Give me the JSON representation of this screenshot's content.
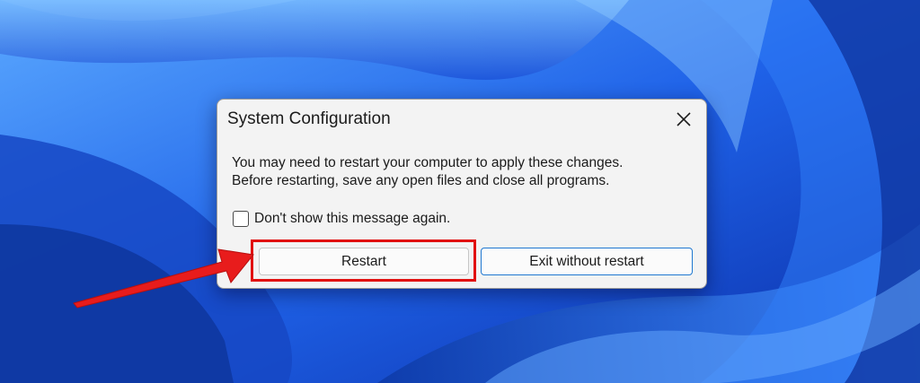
{
  "dialog": {
    "title": "System Configuration",
    "message_line1": "You may need to restart your computer to apply these changes.",
    "message_line2": "Before restarting, save any open files and close all programs.",
    "checkbox_label": "Don't show this message again.",
    "checkbox_checked": false,
    "restart_label": "Restart",
    "exit_label": "Exit without restart"
  },
  "colors": {
    "wallpaper": "#1f5fe0",
    "annotation": "#e11010",
    "focus_border": "#1f78d1"
  },
  "icons": [
    "close-icon",
    "checkbox-icon",
    "annotation-arrow"
  ]
}
